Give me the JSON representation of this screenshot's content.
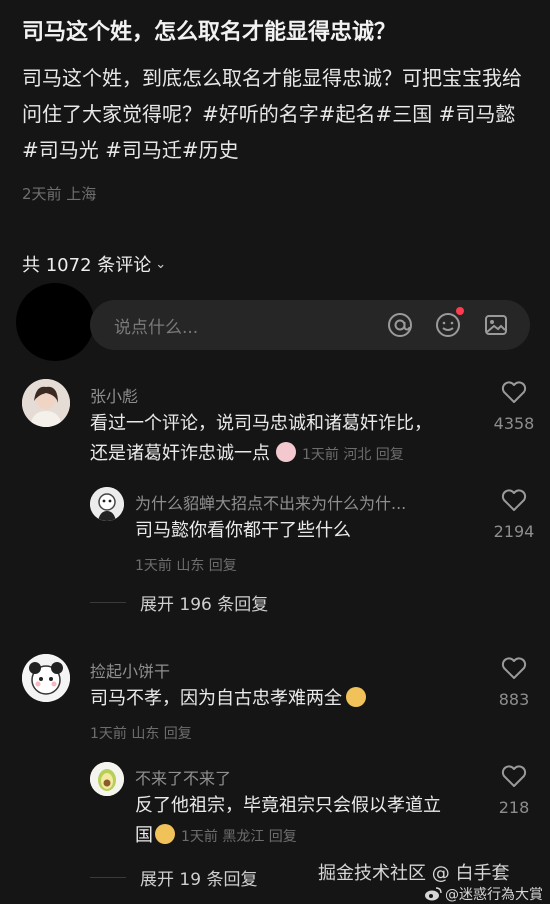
{
  "post": {
    "title": "司马这个姓，怎么取名才能显得忠诚？",
    "body": "司马这个姓，到底怎么取名才能显得忠诚？可把宝宝我给问住了大家觉得呢？",
    "hashtags": [
      "#好听的名字",
      "#起名",
      "#三国",
      "#司马懿",
      "#司马光",
      "#司马迁",
      "#历史"
    ],
    "meta": "2天前 上海"
  },
  "comments_header": {
    "label": "共 1072 条评论"
  },
  "input": {
    "placeholder": "说点什么..."
  },
  "comments": [
    {
      "user": "张小彪",
      "text_line1": "看过一个评论，说司马忠诚和诸葛奸诈比，",
      "text_line2": "还是诸葛奸诈忠诚一点",
      "meta": "1天前 河北 回复",
      "likes": "4358",
      "reply": {
        "user": "为什么貂蝉大招点不出来为什么为什...",
        "text": "司马懿你看你都干了些什么",
        "meta": "1天前 山东 回复",
        "likes": "2194"
      },
      "expand": "展开 196 条回复"
    },
    {
      "user": "捡起小饼干",
      "text_line1": "司马不孝，因为自古忠孝难两全",
      "meta": "1天前 山东 回复",
      "likes": "883",
      "reply": {
        "user": "不来了不来了",
        "text_line1": "反了他祖宗，毕竟祖宗只会假以孝道立",
        "text_line2": "国",
        "meta": "1天前 黑龙江 回复",
        "likes": "218"
      },
      "expand": "展开 19 条回复"
    }
  ],
  "watermark": {
    "line1": "掘金技术社区 @ 白手套",
    "line2": "@迷惑行為大賞"
  },
  "colors": {
    "background": "#151515",
    "accent_dot": "#ff3b4f"
  }
}
